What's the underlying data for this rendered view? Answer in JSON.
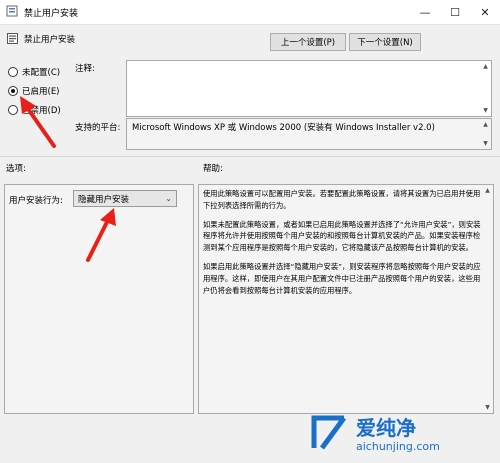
{
  "window": {
    "title": "禁止用户安装",
    "minimize_glyph": "—",
    "maximize_glyph": "☐",
    "close_glyph": "✕"
  },
  "policy": {
    "name": "禁止用户安装"
  },
  "nav": {
    "prev_label": "上一个设置(P)",
    "next_label": "下一个设置(N)"
  },
  "state": {
    "options": [
      {
        "label": "未配置(C)",
        "selected": false
      },
      {
        "label": "已启用(E)",
        "selected": true
      },
      {
        "label": "已禁用(D)",
        "selected": false
      }
    ]
  },
  "comment": {
    "label": "注释:",
    "value": ""
  },
  "supported": {
    "label": "支持的平台:",
    "value": "Microsoft Windows XP 或 Windows 2000 (安装有 Windows Installer v2.0)"
  },
  "options_section": {
    "header": "选项:",
    "field_label": "用户安装行为:",
    "field_value": "隐藏用户安装"
  },
  "help_section": {
    "header": "帮助:",
    "paragraphs": [
      "使用此策略设置可以配置用户安装。若要配置此策略设置，请将其设置为已启用并使用下拉列表选择所需的行为。",
      "如果未配置此策略设置，或者如果已启用此策略设置并选择了“允许用户安装”，则安装程序将允许并使用按照每个用户安装的和按照每台计算机安装的产品。如果安装程序检测到某个应用程序是按照每个用户安装的，它将隐藏该产品按照每台计算机的安装。",
      "如果启用此策略设置并选择“隐藏用户安装”，则安装程序将忽略按照每个用户安装的应用程序。这样，即使用户在其用户配置文件中已注册产品按照每个用户的安装，这些用户仍将会看到按照每台计算机安装的应用程序。"
    ]
  },
  "watermark": {
    "text": "爱纯净",
    "url": "aichunjing.com"
  },
  "colors": {
    "annotation_arrow": "#e8201a",
    "watermark_blue": "#1a6fc9"
  }
}
